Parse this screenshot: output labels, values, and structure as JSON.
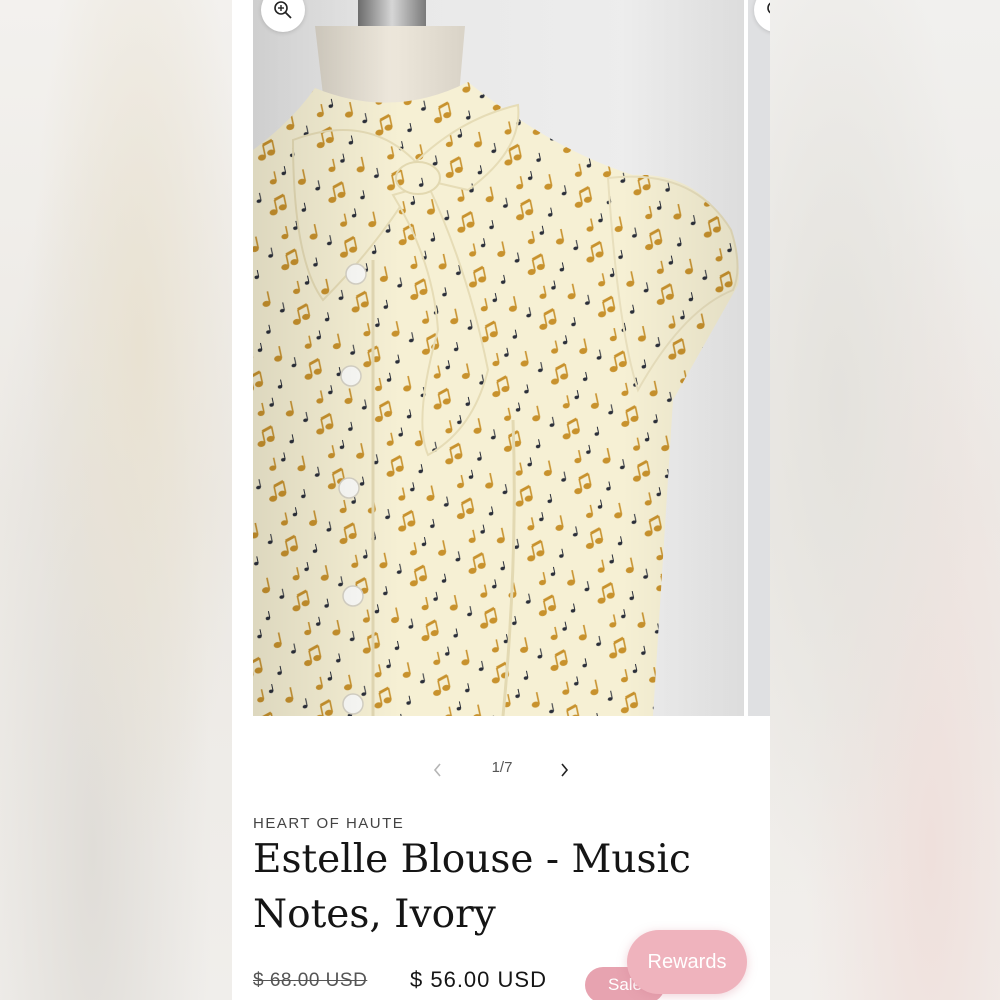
{
  "gallery": {
    "image_alt": "Estelle Blouse - Music Notes, Ivory",
    "zoom_icon": "magnifier-plus-icon",
    "prev_icon": "chevron-left-icon",
    "next_icon": "chevron-right-icon",
    "counter": "1/7"
  },
  "product": {
    "vendor": "HEART OF HAUTE",
    "title": "Estelle Blouse - Music Notes, Ivory",
    "compare_price": "$ 68.00 USD",
    "sale_price": "$ 56.00 USD",
    "badge": "Sale"
  },
  "rewards": {
    "label": "Rewards"
  },
  "colors": {
    "fabric": "#f6f0d4",
    "note_gold": "#c8922d",
    "note_dark": "#2b2f3a",
    "sale_badge": "#e7a3b0",
    "rewards": "#efb3bd"
  }
}
